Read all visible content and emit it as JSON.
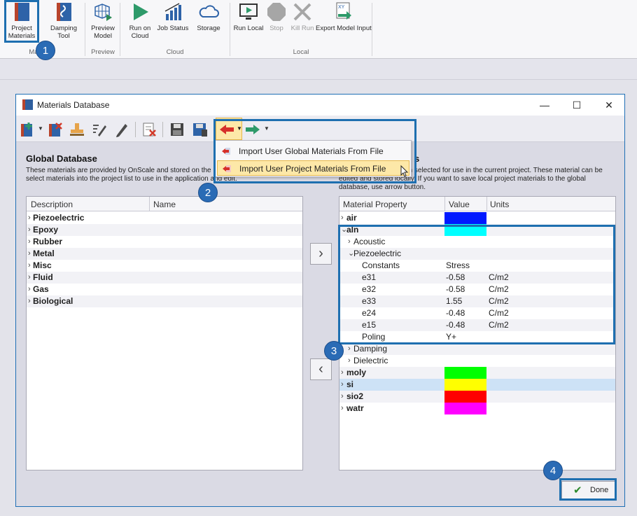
{
  "ribbon": {
    "buttons": [
      {
        "label": "Project\nMaterials",
        "icon": "book-icon"
      },
      {
        "label": "Damping\nTool",
        "icon": "damping-icon"
      },
      {
        "label": "Preview\nModel",
        "icon": "grid-preview-icon"
      },
      {
        "label": "Run on\nCloud",
        "icon": "play-icon"
      },
      {
        "label": "Job Status",
        "icon": "bar-chart-icon"
      },
      {
        "label": "Storage",
        "icon": "cloud-icon"
      },
      {
        "label": "Run Local",
        "icon": "monitor-play-icon"
      },
      {
        "label": "Stop",
        "icon": "stop-icon"
      },
      {
        "label": "Kill Run",
        "icon": "x-icon"
      },
      {
        "label": "Export Model Input",
        "icon": "export-icon"
      }
    ],
    "groups": [
      "Ma",
      "Preview",
      "Cloud",
      "Local"
    ]
  },
  "callouts": [
    "1",
    "2",
    "3",
    "4"
  ],
  "dialog": {
    "title": "Materials Database",
    "controls": {
      "minimize": "—",
      "maximize": "☐",
      "close": "✕"
    },
    "global": {
      "title": "Global Database",
      "desc_line1": "These materials are provided by OnScale and stored on the",
      "desc_line2": "select materials into the project list to use in the application and edit.",
      "columns": [
        "Description",
        "Name"
      ],
      "rows": [
        "Piezoelectric",
        "Epoxy",
        "Rubber",
        "Metal",
        "Misc",
        "Fluid",
        "Gas",
        "Biological"
      ]
    },
    "project": {
      "title_suffix": "s",
      "desc_line1": "en selected for use in the current project. These material can be",
      "desc_line2": "edited and stored locally. If you want to save local project materials to the global",
      "desc_line3": "database, use arrow button.",
      "columns": [
        "Material Property",
        "Value",
        "Units"
      ],
      "rows": [
        {
          "chev": "›",
          "label": "air",
          "bold": true,
          "indent": 0,
          "swatch": "#0019ff"
        },
        {
          "chev": "⌄",
          "label": "aln",
          "bold": true,
          "indent": 0,
          "swatch": "#00ffff"
        },
        {
          "chev": "›",
          "label": "Acoustic",
          "indent": 1
        },
        {
          "chev": "⌄",
          "label": "Piezoelectric",
          "indent": 1
        },
        {
          "label": "Constants",
          "indent": 2,
          "value": "Stress"
        },
        {
          "label": "e31",
          "indent": 2,
          "value": "-0.58",
          "unit": "C/m2"
        },
        {
          "label": "e32",
          "indent": 2,
          "value": "-0.58",
          "unit": "C/m2"
        },
        {
          "label": "e33",
          "indent": 2,
          "value": "1.55",
          "unit": "C/m2"
        },
        {
          "label": "e24",
          "indent": 2,
          "value": "-0.48",
          "unit": "C/m2"
        },
        {
          "label": "e15",
          "indent": 2,
          "value": "-0.48",
          "unit": "C/m2"
        },
        {
          "label": "Poling",
          "indent": 2,
          "value": "Y+"
        },
        {
          "chev": "›",
          "label": "Damping",
          "indent": 1
        },
        {
          "chev": "›",
          "label": "Dielectric",
          "indent": 1
        },
        {
          "chev": "›",
          "label": "moly",
          "bold": true,
          "indent": 0,
          "swatch": "#00ff00"
        },
        {
          "chev": "›",
          "label": "si",
          "bold": true,
          "indent": 0,
          "swatch": "#ffff00"
        },
        {
          "chev": "›",
          "label": "sio2",
          "bold": true,
          "indent": 0,
          "swatch": "#ff0000"
        },
        {
          "chev": "›",
          "label": "watr",
          "bold": true,
          "indent": 0,
          "swatch": "#ff00ff"
        }
      ]
    },
    "menu": {
      "items": [
        "Import User Global Materials From File",
        "Import User Project Materials From File"
      ]
    },
    "arrows": {
      "right": "›",
      "left": "‹"
    },
    "done": "Done"
  }
}
